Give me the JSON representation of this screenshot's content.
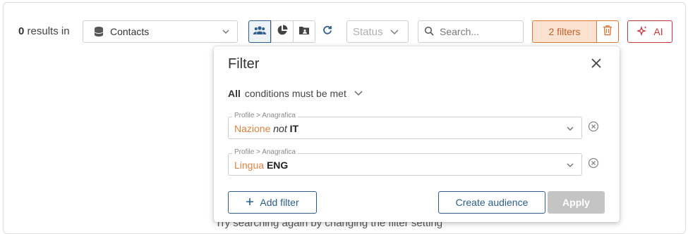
{
  "toolbar": {
    "results_count": "0",
    "results_suffix": " results in",
    "collection_value": "Contacts",
    "status_placeholder": "Status",
    "search_placeholder": "Search...",
    "filters_label": "2 filters",
    "ai_label": "AI"
  },
  "background": {
    "hint_text": "Try searching again by changing the filter setting"
  },
  "filter_popover": {
    "title": "Filter",
    "match_mode": "All",
    "match_suffix": "conditions must be met",
    "rules": [
      {
        "category": "Profile > Anagrafica",
        "field": "Nazione",
        "operator": "not",
        "value": "IT"
      },
      {
        "category": "Profile > Anagrafica",
        "field": "Lingua",
        "operator": "",
        "value": "ENG"
      }
    ],
    "add_filter_label": "Add filter",
    "create_audience_label": "Create audience",
    "apply_label": "Apply"
  },
  "colors": {
    "primary": "#2c5d8f",
    "filter_accent": "#d9793b",
    "field_accent": "#e0823f",
    "ai_accent": "#c9353b",
    "disabled": "#c4c4c4"
  },
  "icons": [
    "database-icon",
    "chevron-down-icon",
    "contacts-view-icon",
    "pie-chart-icon",
    "contact-card-icon",
    "refresh-icon",
    "search-icon",
    "trash-icon",
    "sparkle-icon",
    "close-icon",
    "remove-circle-icon",
    "plus-icon"
  ]
}
